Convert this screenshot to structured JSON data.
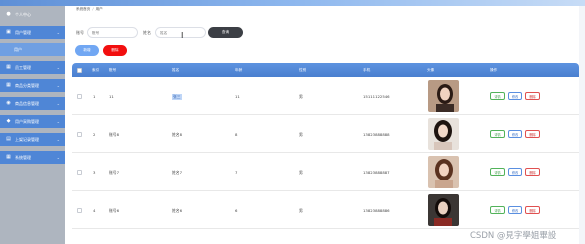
{
  "breadcrumb": {
    "home": "系统首页",
    "current": "用户"
  },
  "sidebar": {
    "items": [
      {
        "label": "个人中心",
        "icon": "user-icon"
      },
      {
        "label": "用户管理",
        "icon": "users-icon"
      },
      {
        "label": "员工管理",
        "icon": "grid-icon"
      },
      {
        "label": "商品分类管理",
        "icon": "grid-icon"
      },
      {
        "label": "商品信息管理",
        "icon": "location-icon"
      },
      {
        "label": "用户采购管理",
        "icon": "shield-icon"
      },
      {
        "label": "上架记录管理",
        "icon": "document-icon"
      },
      {
        "label": "系统管理",
        "icon": "grid-icon"
      }
    ],
    "sub_items": [
      {
        "label": "用户"
      }
    ]
  },
  "search": {
    "account_label": "账号",
    "account_placeholder": "账号",
    "name_label": "姓名",
    "name_placeholder": "姓名",
    "query_label": "查询"
  },
  "actions": {
    "add_label": "新增",
    "delete_label": "删除"
  },
  "table": {
    "headers": [
      "索引",
      "账号",
      "姓名",
      "年龄",
      "性别",
      "手机",
      "头像",
      "操作"
    ],
    "rows": [
      {
        "index": "1",
        "account": "11",
        "name": "张三",
        "age": "11",
        "gender": "男",
        "phone": "15111122546"
      },
      {
        "index": "2",
        "account": "账号8",
        "name": "姓名8",
        "age": "8",
        "gender": "男",
        "phone": "13823888888"
      },
      {
        "index": "3",
        "account": "账号7",
        "name": "姓名7",
        "age": "7",
        "gender": "男",
        "phone": "13823888887"
      },
      {
        "index": "4",
        "account": "账号6",
        "name": "姓名6",
        "age": "6",
        "gender": "男",
        "phone": "13823888886"
      }
    ],
    "row_actions": {
      "detail": "详情",
      "edit": "修改",
      "delete": "删除"
    }
  },
  "watermark": "CSDN @見字學姐畢設",
  "colors": {
    "primary": "#4f86d6",
    "danger": "#f20f0f",
    "query": "#3c3f45",
    "sidebar": "#aeb5bf"
  }
}
